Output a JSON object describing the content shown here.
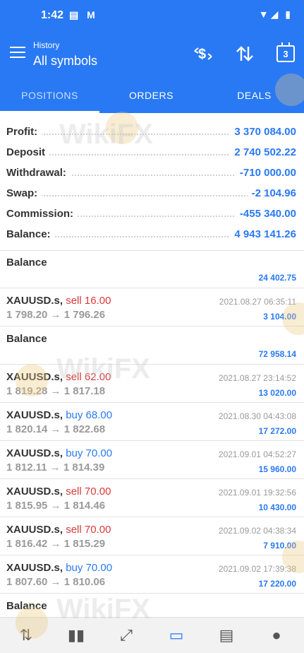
{
  "status": {
    "time": "1:42",
    "left_icons": "▤ M",
    "right_icons": "▼◢ ▮"
  },
  "header": {
    "subtitle": "History",
    "title": "All symbols"
  },
  "tabs": [
    {
      "label": "POSITIONS"
    },
    {
      "label": "ORDERS"
    },
    {
      "label": "DEALS"
    }
  ],
  "calendar_day": "3",
  "summary": [
    {
      "label": "Profit:",
      "value": "3 370 084.00"
    },
    {
      "label": "Deposit",
      "value": "2 740 502.22"
    },
    {
      "label": "Withdrawal:",
      "value": "-710 000.00"
    },
    {
      "label": "Swap:",
      "value": "-2 104.96"
    },
    {
      "label": "Commission:",
      "value": "-455 340.00"
    },
    {
      "label": "Balance:",
      "value": "4 943 141.26"
    }
  ],
  "deals": [
    {
      "kind": "balance",
      "label": "Balance",
      "amount": "24 402.75"
    },
    {
      "kind": "trade",
      "symbol": "XAUUSD.s,",
      "side": "sell",
      "side_text": "sell 16.00",
      "prices": "1 798.20 → 1 796.26",
      "datetime": "2021.08.27 06:35:11",
      "amount": "3 104.00"
    },
    {
      "kind": "balance",
      "label": "Balance",
      "amount": "72 958.14"
    },
    {
      "kind": "trade",
      "symbol": "XAUUSD.s,",
      "side": "sell",
      "side_text": "sell 62.00",
      "prices": "1 819.28 → 1 817.18",
      "datetime": "2021.08.27 23:14:52",
      "amount": "13 020.00"
    },
    {
      "kind": "trade",
      "symbol": "XAUUSD.s,",
      "side": "buy",
      "side_text": "buy 68.00",
      "prices": "1 820.14 → 1 822.68",
      "datetime": "2021.08.30 04:43:08",
      "amount": "17 272.00"
    },
    {
      "kind": "trade",
      "symbol": "XAUUSD.s,",
      "side": "buy",
      "side_text": "buy 70.00",
      "prices": "1 812.11 → 1 814.39",
      "datetime": "2021.09.01 04:52:27",
      "amount": "15 960.00"
    },
    {
      "kind": "trade",
      "symbol": "XAUUSD.s,",
      "side": "sell",
      "side_text": "sell 70.00",
      "prices": "1 815.95 → 1 814.46",
      "datetime": "2021.09.01 19:32:56",
      "amount": "10 430.00"
    },
    {
      "kind": "trade",
      "symbol": "XAUUSD.s,",
      "side": "sell",
      "side_text": "sell 70.00",
      "prices": "1 816.42 → 1 815.29",
      "datetime": "2021.09.02 04:38:34",
      "amount": "7 910.00"
    },
    {
      "kind": "trade",
      "symbol": "XAUUSD.s,",
      "side": "buy",
      "side_text": "buy 70.00",
      "prices": "1 807.60 → 1 810.06",
      "datetime": "2021.09.02 17:39:38",
      "amount": "17 220.00"
    },
    {
      "kind": "balance",
      "label": "Balance",
      "amount": ""
    }
  ],
  "bottom_nav": [
    {
      "name": "quotes-icon",
      "glyph": "⇅"
    },
    {
      "name": "chart-icon",
      "glyph": "▮▮"
    },
    {
      "name": "trade-icon",
      "glyph": "⤢"
    },
    {
      "name": "history-icon",
      "glyph": "▭"
    },
    {
      "name": "news-icon",
      "glyph": "▤"
    },
    {
      "name": "chat-icon",
      "glyph": "●"
    }
  ],
  "watermark": "WikiFX",
  "colors": {
    "accent": "#2979f5",
    "sell": "#d83a3a",
    "buy": "#2979f5"
  }
}
